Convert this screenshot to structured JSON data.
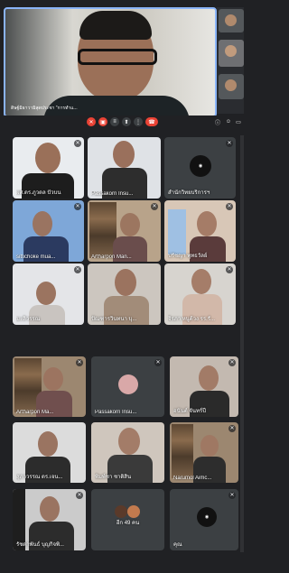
{
  "main": {
    "name": "ดิษฐ์มิธาวามิสุดประชา \"การทำแ...",
    "speaker_icon": "speaker-icon"
  },
  "toolbar": {
    "buttons": [
      "mic-off-icon",
      "camera-off-icon",
      "captions-icon",
      "present-icon",
      "more-icon",
      "end-call-icon"
    ],
    "right_icons": [
      "info-icon",
      "people-icon",
      "chat-icon"
    ]
  },
  "tiles": [
    {
      "name": "ผศ.ดร.ภูวดล ปัวบน"
    },
    {
      "name": "Passakorn Insu..."
    },
    {
      "name": "สำนักวิทยบริการฯ"
    },
    {
      "name": "sittichoke mua..."
    },
    {
      "name": "Artharpon Man..."
    },
    {
      "name": "ปรัชญา พุทธวัลย์"
    },
    {
      "name": "มะลิวรรณ"
    },
    {
      "name": "ปัณฑารวินทนา บุ..."
    },
    {
      "name": "จิรภา หนูด้วง รร.รั..."
    },
    {
      "name": "Artharpon Ma..."
    },
    {
      "name": "Passakorn Insu..."
    },
    {
      "name": "อนันต์ จันทร์ปี"
    },
    {
      "name": "สุภาวรรณ ดร.เจน..."
    },
    {
      "name": "พิมพ์ชา ชาติสิน"
    },
    {
      "name": "Narumol Aimc..."
    },
    {
      "name": "รัชดาพันธ์ บุญกิจพิ..."
    },
    {
      "name": "อีก 49 คน"
    },
    {
      "name": "คุณ"
    }
  ],
  "colors": {
    "accent": "#8ab4f8",
    "end_call": "#ea4335",
    "muted_red": "#ea4335"
  }
}
